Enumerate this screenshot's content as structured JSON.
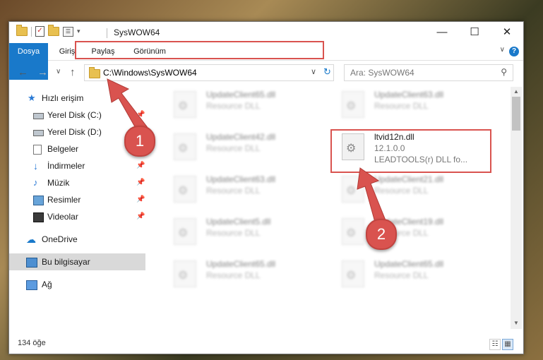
{
  "window": {
    "title": "SysWOW64",
    "minimize_glyph": "—",
    "maximize_glyph": "☐",
    "close_glyph": "✕"
  },
  "ribbon": {
    "tabs": [
      {
        "label": "Dosya"
      },
      {
        "label": "Giriş"
      },
      {
        "label": "Paylaş"
      },
      {
        "label": "Görünüm"
      }
    ],
    "help_glyph": "?",
    "collapse_glyph": "∨"
  },
  "navigation": {
    "back_glyph": "←",
    "forward_glyph": "→",
    "recent_glyph": "∨",
    "up_glyph": "↑",
    "address": "C:\\Windows\\SysWOW64",
    "dropdown_glyph": "∨",
    "refresh_glyph": "↻",
    "search_placeholder": "Ara: SysWOW64",
    "search_glyph": "⚲"
  },
  "sidebar": {
    "items": [
      {
        "label": "Hızlı erişim",
        "icon": "star-icon",
        "pinned": false
      },
      {
        "label": "Yerel Disk (C:)",
        "icon": "drive-icon",
        "pinned": true
      },
      {
        "label": "Yerel Disk (D:)",
        "icon": "drive-icon",
        "pinned": true
      },
      {
        "label": "Belgeler",
        "icon": "documents-icon",
        "pinned": true
      },
      {
        "label": "İndirmeler",
        "icon": "downloads-icon",
        "pinned": true
      },
      {
        "label": "Müzik",
        "icon": "music-icon",
        "pinned": true
      },
      {
        "label": "Resimler",
        "icon": "pictures-icon",
        "pinned": true
      },
      {
        "label": "Videolar",
        "icon": "videos-icon",
        "pinned": true
      },
      {
        "label": "OneDrive",
        "icon": "cloud-icon",
        "pinned": false
      },
      {
        "label": "Bu bilgisayar",
        "icon": "computer-icon",
        "pinned": false,
        "selected": true
      },
      {
        "label": "Ağ",
        "icon": "network-icon",
        "pinned": false
      }
    ],
    "pin_glyph": "📌"
  },
  "files": [
    {
      "name": "UpdateClient65.dll",
      "type": "Resource DLL"
    },
    {
      "name": "UpdateClient63.dll",
      "type": "Resource DLL"
    },
    {
      "name": "UpdateClient42.dll",
      "type": "Resource DLL"
    },
    {
      "name": "ltvid12n.dll",
      "version": "12.1.0.0",
      "description": "LEADTOOLS(r) DLL fo...",
      "highlighted": true
    },
    {
      "name": "UpdateClient63.dll",
      "type": "Resource DLL"
    },
    {
      "name": "UpdateClient21.dll",
      "type": "Resource DLL"
    },
    {
      "name": "UpdateClient5.dll",
      "type": "Resource DLL"
    },
    {
      "name": "UpdateClient19.dll",
      "type": "Resource DLL"
    },
    {
      "name": "UpdateClient65.dll",
      "type": "Resource DLL"
    },
    {
      "name": "UpdateClient65.dll",
      "type": "Resource DLL"
    }
  ],
  "status": {
    "item_count": "134 öğe"
  },
  "annotations": {
    "step1": "1",
    "step2": "2",
    "color": "#d9534f"
  }
}
